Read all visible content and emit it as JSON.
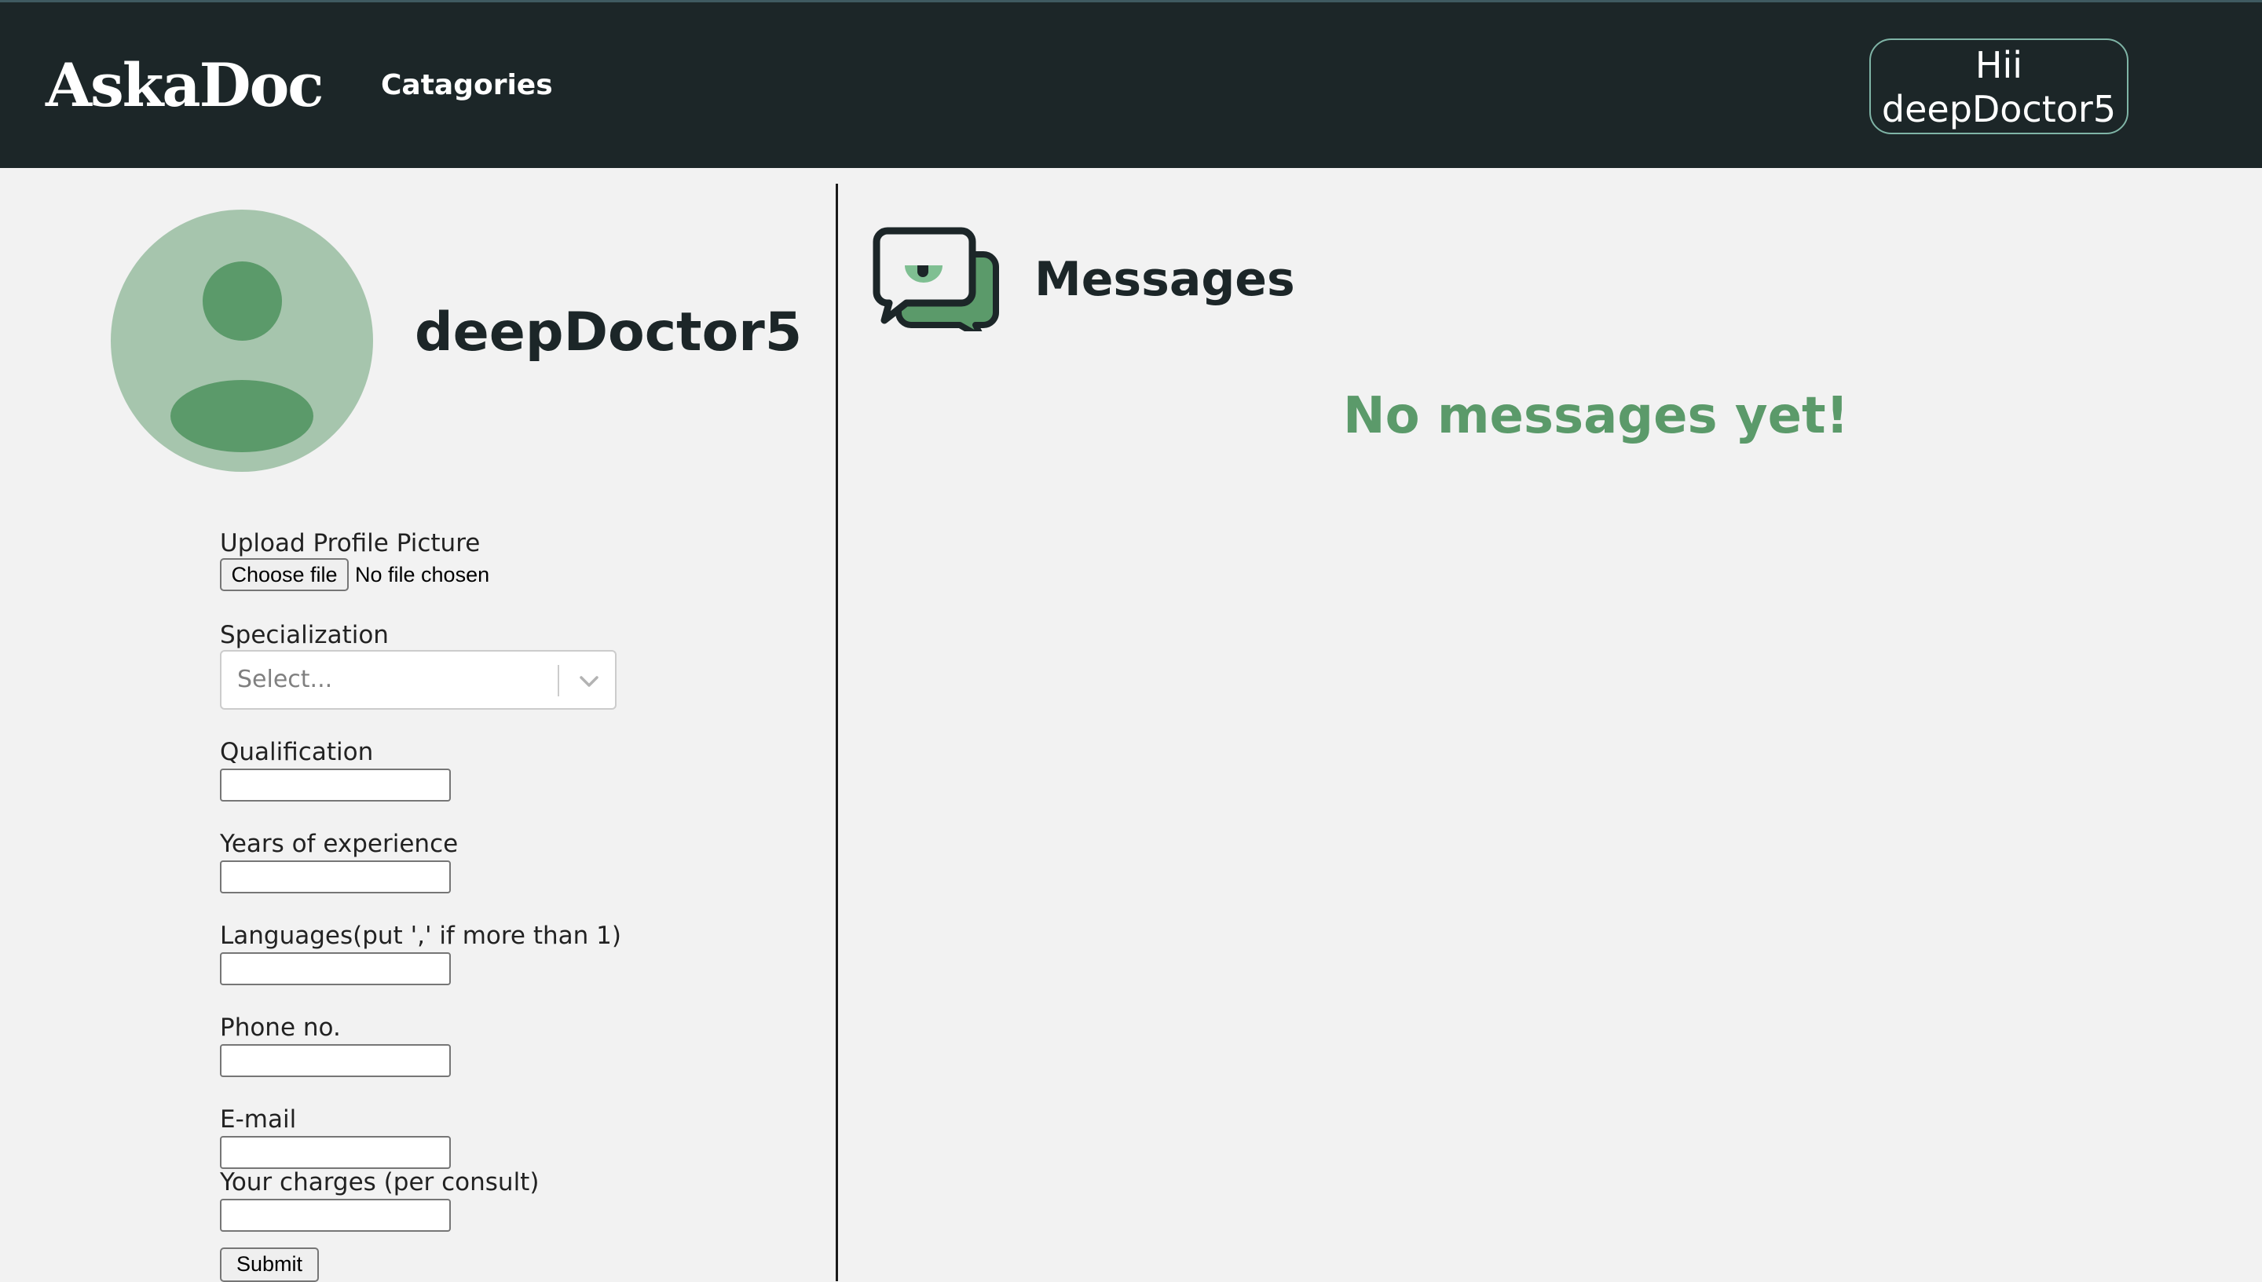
{
  "navbar": {
    "logo": "AskaDoc",
    "nav_link": "Catagories",
    "greeting_line1": "Hii",
    "greeting_line2": "deepDoctor5"
  },
  "profile": {
    "username": "deepDoctor5"
  },
  "form": {
    "upload_label": "Upload Profile Picture",
    "choose_file_label": "Choose file",
    "file_status": "No file chosen",
    "specialization_label": "Specialization",
    "specialization_placeholder": "Select...",
    "qualification_label": "Qualification",
    "qualification_value": "",
    "experience_label": "Years of experience",
    "experience_value": "",
    "languages_label": "Languages(put ',' if more than 1)",
    "languages_value": "",
    "phone_label": "Phone no.",
    "phone_value": "",
    "email_label": "E-mail",
    "email_value": "",
    "charges_label": "Your charges (per consult)",
    "charges_value": "",
    "submit_label": "Submit"
  },
  "messages": {
    "title": "Messages",
    "empty_text": "No messages yet!"
  },
  "colors": {
    "navbar_bg": "#1c2628",
    "page_bg": "#f2f2f2",
    "accent_green": "#5b9a6a",
    "avatar_bg": "#a6c5ad"
  },
  "icons": {
    "avatar": "user-avatar-icon",
    "messages": "chat-bubbles-icon",
    "select_toggle": "chevron-down-icon"
  }
}
